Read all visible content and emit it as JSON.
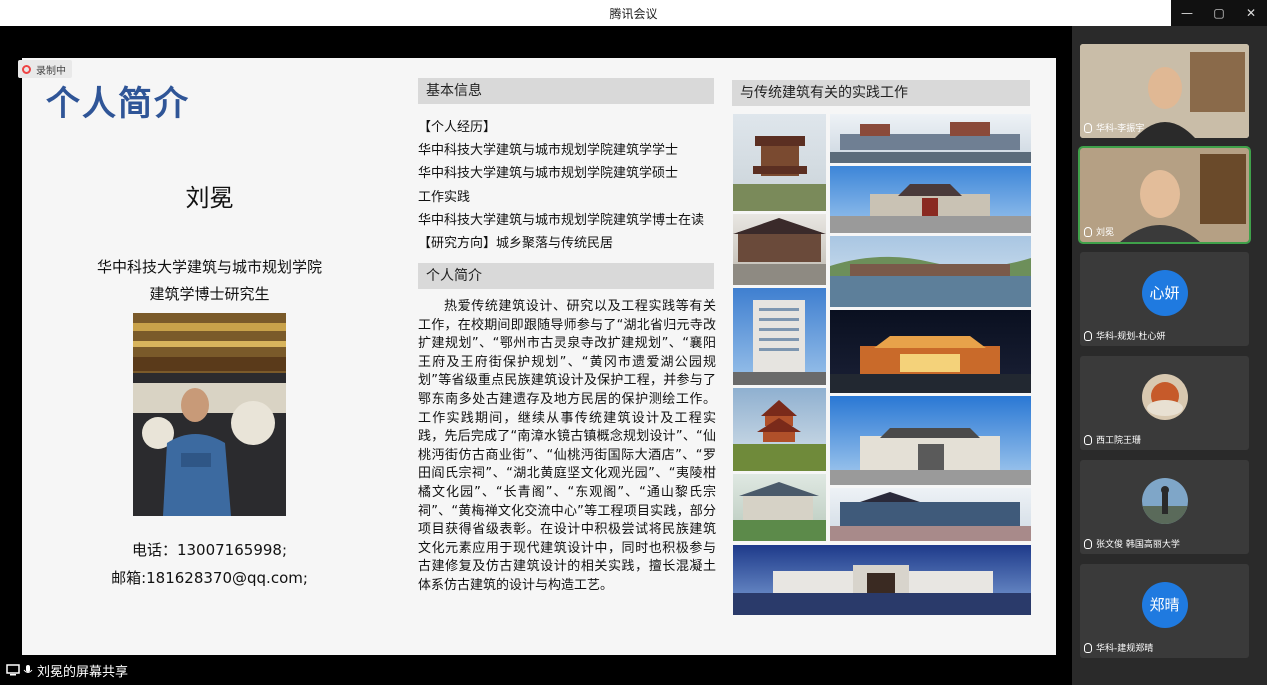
{
  "window": {
    "title": "腾讯会议",
    "controls": [
      "—",
      "▢",
      "✕"
    ]
  },
  "recording": {
    "label": "录制中"
  },
  "slide": {
    "title": "个人简介",
    "name": "刘冕",
    "org_line1": "华中科技大学建筑与城市规划学院",
    "org_line2": "建筑学博士研究生",
    "phone": "电话：13007165998;",
    "email": "邮箱:181628370@qq.com;",
    "basic_head": "基本信息",
    "basic_lines": [
      "【个人经历】",
      "华中科技大学建筑与城市规划学院建筑学学士",
      "华中科技大学建筑与城市规划学院建筑学硕士",
      "工作实践",
      "华中科技大学建筑与城市规划学院建筑学博士在读",
      "【研究方向】城乡聚落与传统民居"
    ],
    "intro_head": "个人简介",
    "intro_text": "热爱传统建筑设计、研究以及工程实践等有关工作，在校期间即跟随导师参与了“湖北省归元寺改扩建规划”、“鄂州市古灵泉寺改扩建规划”、“襄阳王府及王府街保护规划”、“黄冈市遗爱湖公园规划”等省级重点民族建筑设计及保护工程，并参与了鄂东南多处古建遗存及地方民居的保护测绘工作。工作实践期间，继续从事传统建筑设计及工程实践，先后完成了“南漳水镜古镇概念规划设计”、“仙桃沔街仿古商业街”、“仙桃沔街国际大酒店”、“罗田阎氏宗祠”、“湖北黄庭坚文化观光园”、“夷陵柑橘文化园”、“长青阁”、“东观阁”、“通山黎氏宗祠”、“黄梅禅文化交流中心”等工程项目实践，部分项目获得省级表彰。在设计中积极尝试将民族建筑文化元素应用于现代建筑设计中，同时也积极参与古建修复及仿古建筑设计的相关实践，擅长混凝土体系仿古建筑的设计与构造工艺。",
    "practice_head": "与传统建筑有关的实践工作"
  },
  "share_bar": {
    "label": "刘冕的屏幕共享"
  },
  "participants": [
    {
      "label": "华科-李振宇",
      "type": "video",
      "active": false
    },
    {
      "label": "刘冕",
      "type": "video",
      "active": true
    },
    {
      "label": "华科-规划-杜心妍",
      "type": "avatar-text",
      "avatar": "心妍"
    },
    {
      "label": "西工院王珊",
      "type": "avatar-img"
    },
    {
      "label": "张文俊 韩国高丽大学",
      "type": "avatar-img"
    },
    {
      "label": "华科-建规郑晴",
      "type": "avatar-text",
      "avatar": "郑晴"
    }
  ],
  "colors": {
    "accent": "#2f5597",
    "avatar_blue": "#1f7ae0",
    "active_border": "#3fa14a"
  }
}
